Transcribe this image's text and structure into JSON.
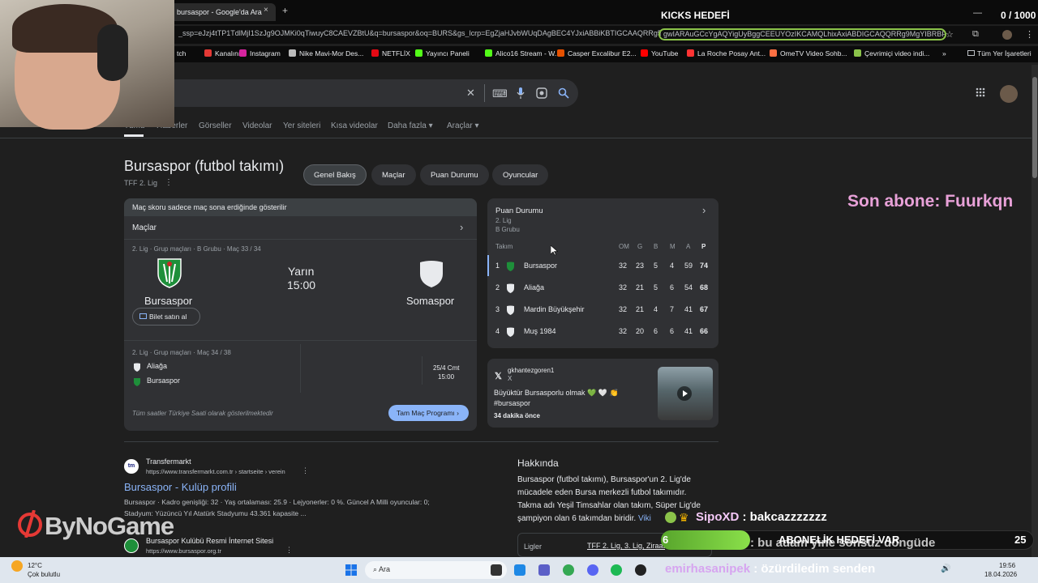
{
  "browser": {
    "tab_title": "bursaspor - Google'da Ara",
    "tab_close": "×",
    "new_tab": "+",
    "url": "_ssp=eJzj4tTP1TdlMjI1SzJg9OJMKi0qTiwuyC8CAEVZBtU&q=bursaspor&oq=BURS&gs_lcrp=EgZjaHJvbWUqDAgBEC4YJxiABBiKBTIGCAAQRRg5MgwI",
    "url_highlight": "gwIARAuGCcYgAQYigUyBggCEEUYOzIKCAMQLhixAxiABDIGCAQQRRg9MgYIBRBF",
    "bookmarks": [
      {
        "label": "tch",
        "color": "#555555"
      },
      {
        "label": "Kanalınız",
        "color": "#e53935"
      },
      {
        "label": "Instagram",
        "color": "#d6249f"
      },
      {
        "label": "Nike Mavi-Mor Des...",
        "color": "#bbbbbb"
      },
      {
        "label": "NETFLİX",
        "color": "#e50914"
      },
      {
        "label": "Yayıncı Paneli",
        "color": "#53fc18"
      },
      {
        "label": "Alico16 Stream - W...",
        "color": "#53fc18"
      },
      {
        "label": "Casper Excalibur E2...",
        "color": "#e65100"
      },
      {
        "label": "YouTube",
        "color": "#ff0000"
      },
      {
        "label": "La Roche Posay Ant...",
        "color": "#ff3333"
      },
      {
        "label": "OmeTV Video Sohb...",
        "color": "#ff7043"
      },
      {
        "label": "Çevrimiçi video indi...",
        "color": "#8bc34a"
      }
    ],
    "bookmarks_more": "»",
    "all_bookmarks": "Tüm Yer İşaretleri"
  },
  "stream": {
    "kicks_title": "KICKS HEDEFİ",
    "kicks_count": "0 / 1000",
    "last_sub": "Son abone: Fuurkqn",
    "brand": "ByNoGame",
    "chat1_name": "SipoXD",
    "chat1_msg": ": bakcazzzzzzz",
    "goal_left": "6",
    "goal_text": "ABONELİK HEDEFİ VAR",
    "goal_right": "25",
    "goal_fraction": 0.24,
    "chat2_msg": ": bu adam yine sonsuz döngüde",
    "chat3_name": "emirhasanipek",
    "chat3_msg": ": özürdiledim senden"
  },
  "search": {
    "clear_icon": "✕",
    "apps_icon": "⋮⋮⋮",
    "nav_tabs": [
      "Tümü",
      "Haberler",
      "Görseller",
      "Videolar",
      "Yer siteleri",
      "Kısa videolar",
      "Daha fazla ▾",
      "Araçlar ▾"
    ]
  },
  "entity": {
    "title": "Bursaspor (futbol takımı)",
    "subtitle": "TFF 2. Lig",
    "more_icon": "⋮",
    "chips": [
      "Genel Bakış",
      "Maçlar",
      "Puan Durumu",
      "Oyuncular"
    ]
  },
  "matches": {
    "note": "Maç skoru sadece maç sona erdiğinde gösterilir",
    "header": "Maçlar",
    "chevron": "›",
    "match1_meta": "2. Lig · Grup maçları · B Grubu · Maç 33 / 34",
    "home": "Bursaspor",
    "away": "Somaspor",
    "day": "Yarın",
    "time": "15:00",
    "ticket": "Bilet satın al",
    "match2_meta": "2. Lig · Grup maçları · Maç 34 / 38",
    "m2_team1": "Aliağa",
    "m2_team2": "Bursaspor",
    "m2_date": "25/4 Cmt",
    "m2_time": "15:00",
    "footer_note": "Tüm saatler Türkiye Saati olarak gösterilmektedir",
    "full_schedule": "Tam Maç Programı ›"
  },
  "standings": {
    "title": "Puan Durumu",
    "sub1": "2. Lig",
    "sub2": "B Grubu",
    "chevron": "›",
    "headers": [
      "Takım",
      "OM",
      "G",
      "B",
      "M",
      "A",
      "P"
    ],
    "rows": [
      {
        "pos": "1",
        "team": "Bursaspor",
        "om": "32",
        "g": "23",
        "b": "5",
        "m": "4",
        "a": "59",
        "p": "74"
      },
      {
        "pos": "2",
        "team": "Aliağa",
        "om": "32",
        "g": "21",
        "b": "5",
        "m": "6",
        "a": "54",
        "p": "68"
      },
      {
        "pos": "3",
        "team": "Mardin Büyükşehir",
        "om": "32",
        "g": "21",
        "b": "4",
        "m": "7",
        "a": "41",
        "p": "67"
      },
      {
        "pos": "4",
        "team": "Muş 1984",
        "om": "32",
        "g": "20",
        "b": "6",
        "m": "6",
        "a": "41",
        "p": "66"
      }
    ]
  },
  "post": {
    "author": "gkhantezgoren1",
    "platform": "X",
    "text1": "Büyüktür Bursasporlu olmak 💚 🤍 👏",
    "text2": "#bursaspor",
    "time": "34 dakika önce"
  },
  "results": [
    {
      "source": "Transfermarkt",
      "url": "https://www.transfermarkt.com.tr › startseite › verein",
      "title": "Bursaspor - Kulüp profili",
      "snippet1": "Bursaspor · Kadro genişliği: 32 · Yaş ortalaması: 25.9 · Lejyonerler: 0 %. Güncel A Milli oyuncular: 0;",
      "snippet2": "Stadyum: Yüzüncü Yıl Atatürk Stadyumu 43.361 kapasite ..."
    },
    {
      "source": "Bursaspor Kulübü Resmi İnternet Sitesi",
      "url": "https://www.bursaspor.org.tr"
    }
  ],
  "about": {
    "heading": "Hakkında",
    "text": "Bursaspor (futbol takımı), Bursaspor'un 2. Lig'de mücadele eden Bursa merkezli futbol takımıdır. Takma adı Yeşil Timsahlar olan takım, Süper Lig'de şampiyon olan 6 takımdan biridir.",
    "wiki": "Viki",
    "leagues_label": "Ligler",
    "leagues_value": "TFF 2. Lig, 3. Lig, Ziraat"
  },
  "taskbar": {
    "temp": "12°C",
    "weather": "Çok bulutlu",
    "search": "Ara",
    "time": "19:56",
    "date": "18.04.2026"
  }
}
